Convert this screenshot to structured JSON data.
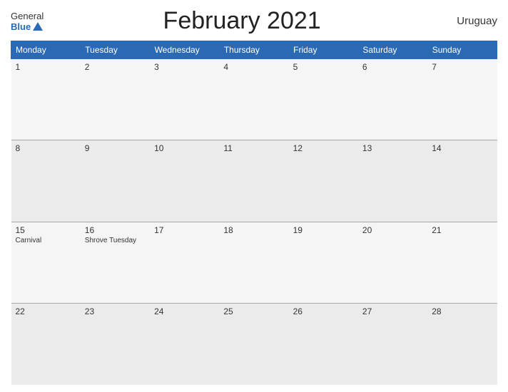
{
  "header": {
    "logo_general": "General",
    "logo_blue": "Blue",
    "title": "February 2021",
    "country": "Uruguay"
  },
  "days_of_week": [
    "Monday",
    "Tuesday",
    "Wednesday",
    "Thursday",
    "Friday",
    "Saturday",
    "Sunday"
  ],
  "weeks": [
    [
      {
        "day": "1",
        "event": ""
      },
      {
        "day": "2",
        "event": ""
      },
      {
        "day": "3",
        "event": ""
      },
      {
        "day": "4",
        "event": ""
      },
      {
        "day": "5",
        "event": ""
      },
      {
        "day": "6",
        "event": ""
      },
      {
        "day": "7",
        "event": ""
      }
    ],
    [
      {
        "day": "8",
        "event": ""
      },
      {
        "day": "9",
        "event": ""
      },
      {
        "day": "10",
        "event": ""
      },
      {
        "day": "11",
        "event": ""
      },
      {
        "day": "12",
        "event": ""
      },
      {
        "day": "13",
        "event": ""
      },
      {
        "day": "14",
        "event": ""
      }
    ],
    [
      {
        "day": "15",
        "event": "Carnival"
      },
      {
        "day": "16",
        "event": "Shrove Tuesday"
      },
      {
        "day": "17",
        "event": ""
      },
      {
        "day": "18",
        "event": ""
      },
      {
        "day": "19",
        "event": ""
      },
      {
        "day": "20",
        "event": ""
      },
      {
        "day": "21",
        "event": ""
      }
    ],
    [
      {
        "day": "22",
        "event": ""
      },
      {
        "day": "23",
        "event": ""
      },
      {
        "day": "24",
        "event": ""
      },
      {
        "day": "25",
        "event": ""
      },
      {
        "day": "26",
        "event": ""
      },
      {
        "day": "27",
        "event": ""
      },
      {
        "day": "28",
        "event": ""
      }
    ]
  ]
}
